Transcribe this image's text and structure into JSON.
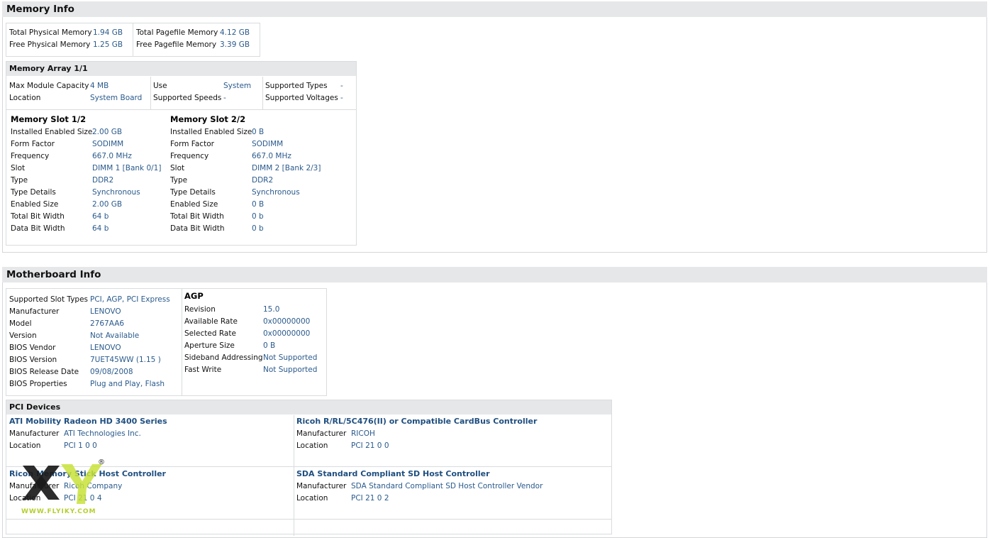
{
  "memory_section": {
    "title": "Memory Info",
    "totals": [
      {
        "label": "Total Physical Memory",
        "value": "1.94 GB"
      },
      {
        "label": "Free Physical Memory",
        "value": "1.25 GB"
      },
      {
        "label": "Total Pagefile Memory",
        "value": "4.12 GB"
      },
      {
        "label": "Free Pagefile Memory",
        "value": "3.39 GB"
      }
    ],
    "array": {
      "title": "Memory Array 1/1",
      "fields": [
        {
          "label": "Max Module Capacity",
          "value": "4 MB"
        },
        {
          "label": "Location",
          "value": "System Board"
        },
        {
          "label": "Use",
          "value": "System"
        },
        {
          "label": "Supported Speeds",
          "value": "-"
        },
        {
          "label": "Supported Types",
          "value": "-"
        },
        {
          "label": "Supported Voltages",
          "value": "-"
        }
      ]
    },
    "slots": [
      {
        "title": "Memory Slot 1/2",
        "fields": [
          {
            "label": "Installed Enabled Size",
            "value": "2.00 GB"
          },
          {
            "label": "Form Factor",
            "value": "SODIMM"
          },
          {
            "label": "Frequency",
            "value": "667.0 MHz"
          },
          {
            "label": "Slot",
            "value": "DIMM 1 [Bank 0/1]"
          },
          {
            "label": "Type",
            "value": "DDR2"
          },
          {
            "label": "Type Details",
            "value": "Synchronous"
          },
          {
            "label": "Enabled Size",
            "value": "2.00 GB"
          },
          {
            "label": "Total Bit Width",
            "value": "64 b"
          },
          {
            "label": "Data Bit Width",
            "value": "64 b"
          }
        ]
      },
      {
        "title": "Memory Slot 2/2",
        "fields": [
          {
            "label": "Installed Enabled Size",
            "value": "0 B"
          },
          {
            "label": "Form Factor",
            "value": "SODIMM"
          },
          {
            "label": "Frequency",
            "value": "667.0 MHz"
          },
          {
            "label": "Slot",
            "value": "DIMM 2 [Bank 2/3]"
          },
          {
            "label": "Type",
            "value": "DDR2"
          },
          {
            "label": "Type Details",
            "value": "Synchronous"
          },
          {
            "label": "Enabled Size",
            "value": "0 B"
          },
          {
            "label": "Total Bit Width",
            "value": "0 b"
          },
          {
            "label": "Data Bit Width",
            "value": "0 b"
          }
        ]
      }
    ]
  },
  "motherboard_section": {
    "title": "Motherboard Info",
    "fields": [
      {
        "label": "Supported Slot Types",
        "value": "PCI, AGP, PCI Express"
      },
      {
        "label": "Manufacturer",
        "value": "LENOVO"
      },
      {
        "label": "Model",
        "value": "2767AA6"
      },
      {
        "label": "Version",
        "value": "Not Available"
      },
      {
        "label": "BIOS Vendor",
        "value": "LENOVO"
      },
      {
        "label": "BIOS Version",
        "value": "7UET45WW (1.15 )"
      },
      {
        "label": "BIOS Release Date",
        "value": "09/08/2008"
      },
      {
        "label": "BIOS Properties",
        "value": "Plug and Play, Flash"
      }
    ],
    "agp": {
      "title": "AGP",
      "fields": [
        {
          "label": "Revision",
          "value": "15.0"
        },
        {
          "label": "Available Rate",
          "value": "0x00000000"
        },
        {
          "label": "Selected Rate",
          "value": "0x00000000"
        },
        {
          "label": "Aperture Size",
          "value": "0 B"
        },
        {
          "label": "Sideband Addressing",
          "value": "Not Supported"
        },
        {
          "label": "Fast Write",
          "value": "Not Supported"
        }
      ]
    },
    "pci": {
      "title": "PCI Devices",
      "manufacturer_label": "Manufacturer",
      "location_label": "Location",
      "devices": [
        {
          "name": "ATI Mobility Radeon HD 3400 Series",
          "manufacturer": "ATI Technologies Inc.",
          "location": "PCI 1 0 0"
        },
        {
          "name": "Ricoh R/RL/5C476(II) or Compatible CardBus Controller",
          "manufacturer": "RICOH",
          "location": "PCI 21 0 0"
        },
        {
          "name": "Ricoh Memory Stick Host Controller",
          "manufacturer": "Ricoh Company",
          "location": "PCI 21 0 4"
        },
        {
          "name": "SDA Standard Compliant SD Host Controller",
          "manufacturer": "SDA Standard Compliant SD Host Controller Vendor",
          "location": "PCI 21 0 2"
        }
      ]
    }
  },
  "watermark": {
    "text": "WWW.FLYIKY.COM",
    "mark": "®"
  }
}
